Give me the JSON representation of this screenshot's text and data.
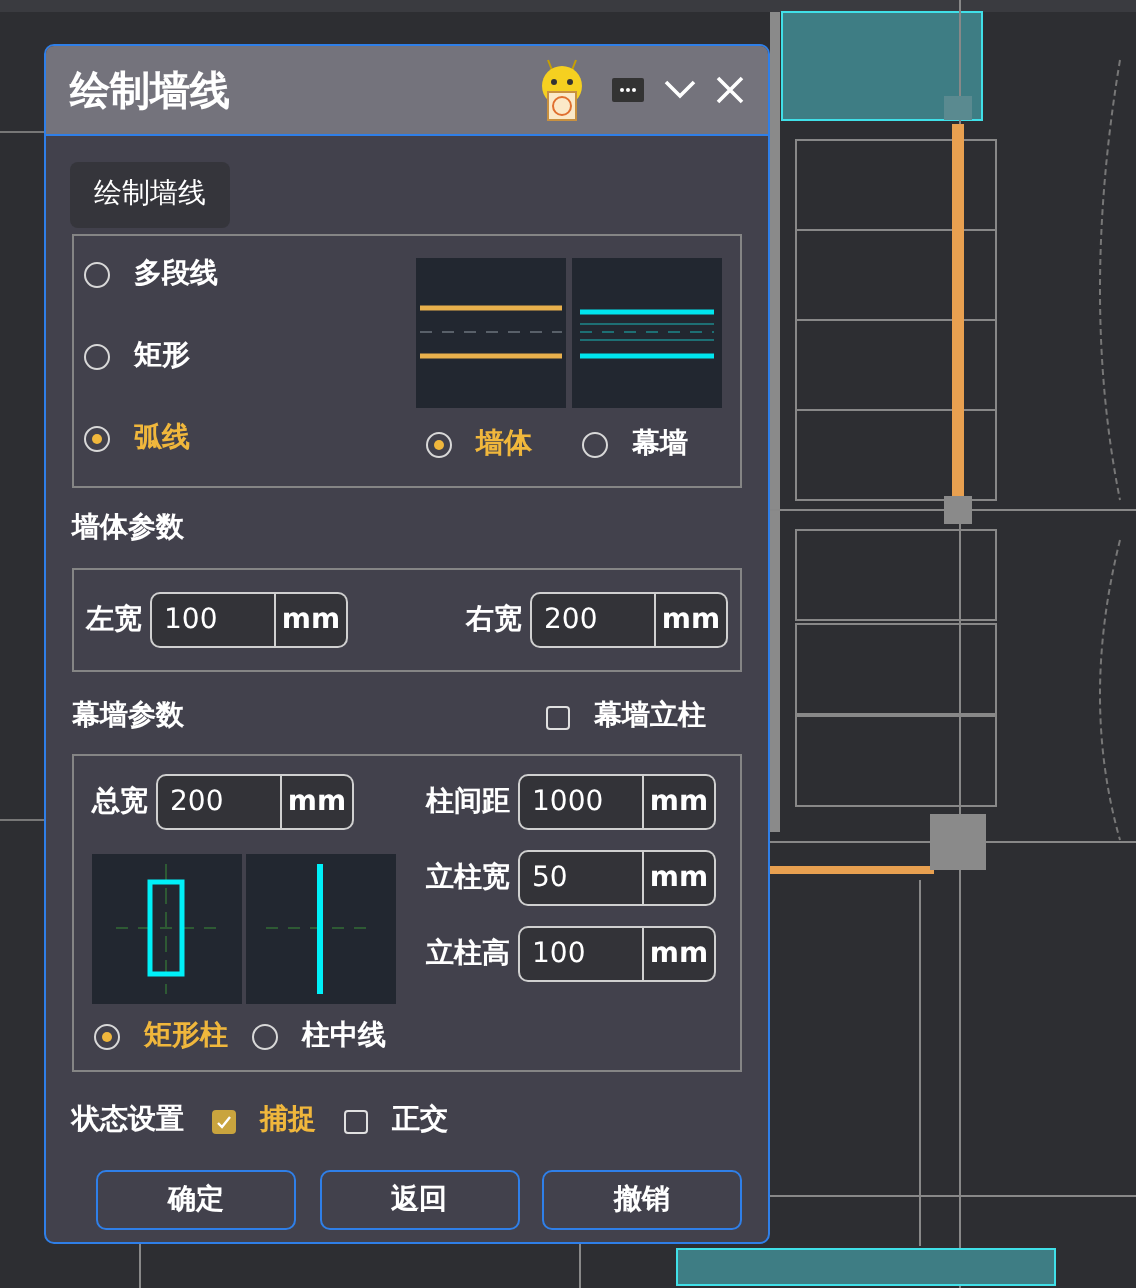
{
  "window": {
    "title": "绘制墙线",
    "tooltip": "绘制墙线"
  },
  "draw_modes": [
    {
      "label": "多段线",
      "selected": false
    },
    {
      "label": "矩形",
      "selected": false
    },
    {
      "label": "弧线",
      "selected": true
    }
  ],
  "wall_types": [
    {
      "label": "墙体",
      "selected": true,
      "kind": "wall"
    },
    {
      "label": "幕墙",
      "selected": false,
      "kind": "curtain"
    }
  ],
  "wall_params": {
    "title": "墙体参数",
    "fields": [
      {
        "label": "左宽",
        "value": "100",
        "unit": "mm"
      },
      {
        "label": "右宽",
        "value": "200",
        "unit": "mm"
      }
    ]
  },
  "curtain_params": {
    "title": "幕墙参数",
    "mullion": {
      "label": "幕墙立柱",
      "checked": false
    },
    "width": {
      "label": "总宽",
      "value": "200",
      "unit": "mm"
    },
    "fields": [
      {
        "label": "柱间距",
        "value": "1000",
        "unit": "mm"
      },
      {
        "label": "立柱宽",
        "value": "50",
        "unit": "mm"
      },
      {
        "label": "立柱高",
        "value": "100",
        "unit": "mm"
      }
    ],
    "column_types": [
      {
        "label": "矩形柱",
        "selected": true,
        "kind": "rect"
      },
      {
        "label": "柱中线",
        "selected": false,
        "kind": "centerline"
      }
    ]
  },
  "state": {
    "title": "状态设置",
    "options": [
      {
        "label": "捕捉",
        "checked": true
      },
      {
        "label": "正交",
        "checked": false
      }
    ]
  },
  "buttons": [
    "确定",
    "返回",
    "撤销"
  ]
}
